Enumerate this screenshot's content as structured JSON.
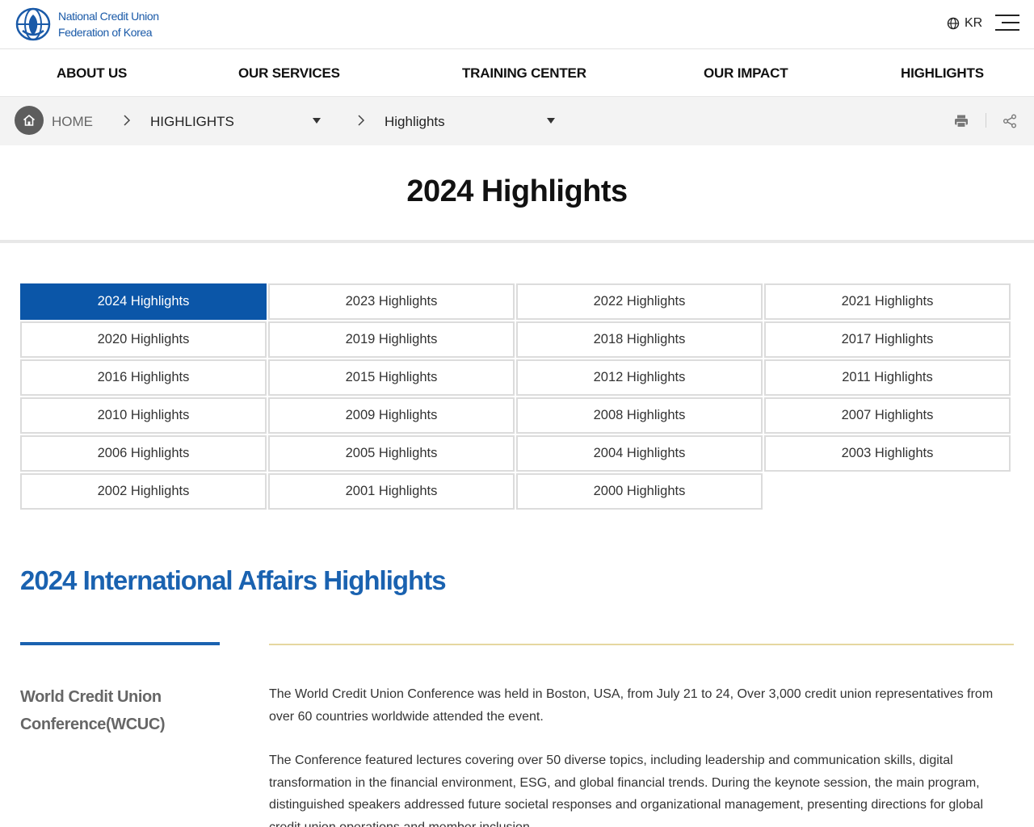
{
  "header": {
    "logo_line1": "National Credit Union",
    "logo_line2": "Federation of Korea",
    "lang_label": "KR"
  },
  "nav": {
    "items": [
      "ABOUT US",
      "OUR SERVICES",
      "TRAINING CENTER",
      "OUR IMPACT",
      "HIGHLIGHTS"
    ]
  },
  "breadcrumb": {
    "home_label": "HOME",
    "level1": "HIGHLIGHTS",
    "level2": "Highlights"
  },
  "page": {
    "title": "2024 Highlights"
  },
  "years": {
    "active": "2024 Highlights",
    "items": [
      "2024 Highlights",
      "2023 Highlights",
      "2022 Highlights",
      "2021 Highlights",
      "2020 Highlights",
      "2019 Highlights",
      "2018 Highlights",
      "2017 Highlights",
      "2016 Highlights",
      "2015 Highlights",
      "2012 Highlights",
      "2011 Highlights",
      "2010 Highlights",
      "2009 Highlights",
      "2008 Highlights",
      "2007 Highlights",
      "2006 Highlights",
      "2005 Highlights",
      "2004 Highlights",
      "2003 Highlights",
      "2002 Highlights",
      "2001 Highlights",
      "2000 Highlights"
    ]
  },
  "section": {
    "title": "2024 International Affairs Highlights",
    "sub_heading": "World Credit Union Conference(WCUC)",
    "paragraph1": "The World Credit Union Conference was held in Boston, USA, from July 21 to 24, Over 3,000 credit union representatives from over 60 countries worldwide attended the event.",
    "paragraph2": "The Conference featured lectures covering over 50 diverse topics, including leadership and communication skills, digital transformation in the financial environment, ESG, and global financial trends. During the keynote session, the main program, distinguished speakers addressed future societal responses and organizational management, presenting directions for global credit union operations and member inclusion."
  },
  "colors": {
    "brand_blue": "#0b56a8",
    "title_blue": "#1a62b0",
    "gold_rule": "#e6d7a0"
  },
  "icons": [
    "logo-emblem-icon",
    "globe-icon",
    "hamburger-menu-icon",
    "home-icon",
    "chevron-right-icon",
    "caret-down-icon",
    "print-icon",
    "share-icon"
  ]
}
